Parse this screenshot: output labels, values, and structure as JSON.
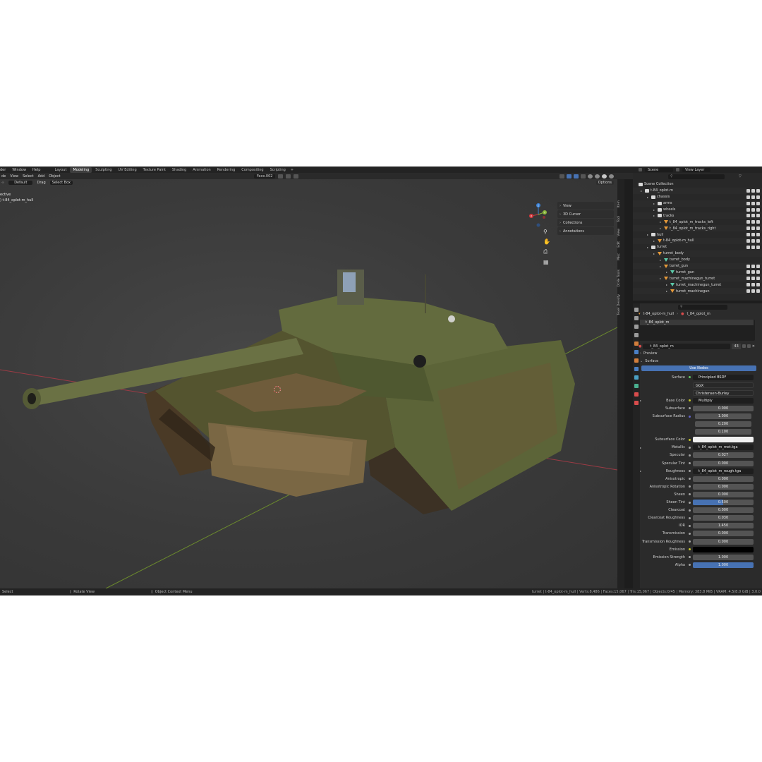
{
  "menu": [
    "der",
    "Window",
    "Help"
  ],
  "workspaces": {
    "tabs": [
      "Layout",
      "Modeling",
      "Sculpting",
      "UV Editing",
      "Texture Paint",
      "Shading",
      "Animation",
      "Rendering",
      "Compositing",
      "Scripting"
    ],
    "active": "Modeling",
    "add": "+"
  },
  "viewport_header": {
    "mode": "de",
    "menus": [
      "View",
      "Select",
      "Add",
      "Object"
    ],
    "orientation": "Default",
    "drag": "Drag",
    "select_box": "Select Box",
    "face_selector": "Face.002",
    "options": "Options"
  },
  "viewport": {
    "info_line1": "ective",
    "info_line2": ") t-84_oplot-m_hull",
    "sidebar_rows": [
      "View",
      "3D Cursor",
      "Collections",
      "Annotations"
    ],
    "vertical_tabs": [
      "Item",
      "Tool",
      "View",
      "Edit",
      "Misc",
      "DcHe Tools",
      "Texel Density"
    ],
    "gizmo_axes": [
      "X",
      "Y",
      "Z"
    ]
  },
  "outliner": {
    "scene": "Scene",
    "view_layer": "View Layer",
    "tree": [
      {
        "label": "Scene Collection",
        "depth": 0,
        "type": "col",
        "vis": false
      },
      {
        "label": "t-84_oplot-m",
        "depth": 1,
        "type": "col",
        "vis": true
      },
      {
        "label": "chassis",
        "depth": 2,
        "type": "col",
        "vis": true
      },
      {
        "label": "arms",
        "depth": 3,
        "type": "col",
        "vis": true
      },
      {
        "label": "wheels",
        "depth": 3,
        "type": "col",
        "vis": true
      },
      {
        "label": "tracks",
        "depth": 3,
        "type": "col",
        "vis": true
      },
      {
        "label": "t_84_oplot_m_tracks_left",
        "depth": 4,
        "type": "obj",
        "vis": true
      },
      {
        "label": "t_84_oplot_m_tracks_right",
        "depth": 4,
        "type": "obj",
        "vis": true
      },
      {
        "label": "hull",
        "depth": 2,
        "type": "col",
        "vis": true
      },
      {
        "label": "t-84_oplot-m_hull",
        "depth": 3,
        "type": "obj",
        "vis": true
      },
      {
        "label": "turret",
        "depth": 2,
        "type": "col",
        "vis": true
      },
      {
        "label": "turret_body",
        "depth": 3,
        "type": "obj",
        "vis": false
      },
      {
        "label": "turret_body",
        "depth": 4,
        "type": "mesh",
        "vis": false
      },
      {
        "label": "turret_gun",
        "depth": 4,
        "type": "obj",
        "vis": true
      },
      {
        "label": "turret_gun",
        "depth": 5,
        "type": "mesh",
        "vis": true
      },
      {
        "label": "turret_machinegun_turret",
        "depth": 4,
        "type": "obj",
        "vis": true
      },
      {
        "label": "turret_machinegun_turret",
        "depth": 5,
        "type": "mesh",
        "vis": true
      },
      {
        "label": "turret_machinegun",
        "depth": 5,
        "type": "obj",
        "vis": true
      }
    ]
  },
  "properties": {
    "breadcrumb_object": "t-84_oplot-m_hull",
    "breadcrumb_material": "t_84_oplot_m",
    "slot": "t_84_oplot_m",
    "material_name": "t_84_oplot_m",
    "material_users": "43",
    "preview": "Preview",
    "surface_panel": "Surface",
    "use_nodes": "Use Nodes",
    "rows": [
      {
        "label": "Surface",
        "value": "Principled BSDF",
        "kind": "text",
        "dot": "green"
      },
      {
        "label": "",
        "value": "GGX",
        "kind": "drop"
      },
      {
        "label": "",
        "value": "Christensen-Burley",
        "kind": "drop"
      },
      {
        "label": "Base Color",
        "value": "Multiply",
        "kind": "text",
        "dot": "yellow",
        "tri": true
      },
      {
        "label": "Subsurface",
        "value": "0.000",
        "kind": "num",
        "dot": "grey"
      },
      {
        "label": "Subsurface Radius",
        "value": "1.000",
        "kind": "num",
        "dot": "purple",
        "narrow": true
      },
      {
        "label": "",
        "value": "0.200",
        "kind": "num",
        "narrow": true
      },
      {
        "label": "",
        "value": "0.100",
        "kind": "num",
        "narrow": true
      },
      {
        "label": "Subsurface Color",
        "value": "",
        "kind": "sw-white",
        "dot": "yellow"
      },
      {
        "label": "Metallic",
        "value": "t_84_oplot_m_met.tga",
        "kind": "text",
        "dot": "grey",
        "tri": true
      },
      {
        "label": "Specular",
        "value": "0.027",
        "kind": "num",
        "dot": "grey"
      },
      {
        "label": "Specular Tint",
        "value": "0.000",
        "kind": "num",
        "dot": "grey"
      },
      {
        "label": "Roughness",
        "value": "t_84_oplot_m_rough.tga",
        "kind": "text",
        "dot": "grey",
        "tri": true
      },
      {
        "label": "Anisotropic",
        "value": "0.000",
        "kind": "num",
        "dot": "grey"
      },
      {
        "label": "Anisotropic Rotation",
        "value": "0.000",
        "kind": "num",
        "dot": "grey"
      },
      {
        "label": "Sheen",
        "value": "0.000",
        "kind": "num",
        "dot": "grey"
      },
      {
        "label": "Sheen Tint",
        "value": "0.500",
        "kind": "num",
        "dot": "grey",
        "fill": 0.5
      },
      {
        "label": "Clearcoat",
        "value": "0.000",
        "kind": "num",
        "dot": "grey"
      },
      {
        "label": "Clearcoat Roughness",
        "value": "0.030",
        "kind": "num",
        "dot": "grey"
      },
      {
        "label": "IOR",
        "value": "1.450",
        "kind": "num",
        "dot": "grey"
      },
      {
        "label": "Transmission",
        "value": "0.000",
        "kind": "num",
        "dot": "grey"
      },
      {
        "label": "Transmission Roughness",
        "value": "0.000",
        "kind": "num",
        "dot": "grey"
      },
      {
        "label": "Emission",
        "value": "",
        "kind": "sw-black",
        "dot": "yellow"
      },
      {
        "label": "Emission Strength",
        "value": "1.000",
        "kind": "num",
        "dot": "grey"
      },
      {
        "label": "Alpha",
        "value": "1.000",
        "kind": "num",
        "dot": "grey",
        "fill": 1.0
      }
    ]
  },
  "statusbar": {
    "hints": [
      "Select",
      "Rotate View",
      "Object Context Menu"
    ],
    "stats": "turret | t-84_oplot-m_hull | Verts:8,486 | Faces:15,067 | Tris:15,067 | Objects:0/45 | Memory: 383.8 MiB | VRAM: 4.5/8.0 GiB | 3.0.0"
  },
  "colors": {
    "accent": "#4772b3",
    "window_bg": "#1d1d1d",
    "viewport_bg": "#3d3d3d",
    "panel_bg": "#2b2b2b",
    "x_axis": "#d2373c",
    "y_axis": "#8bb73a",
    "z_axis": "#3b82d6"
  }
}
